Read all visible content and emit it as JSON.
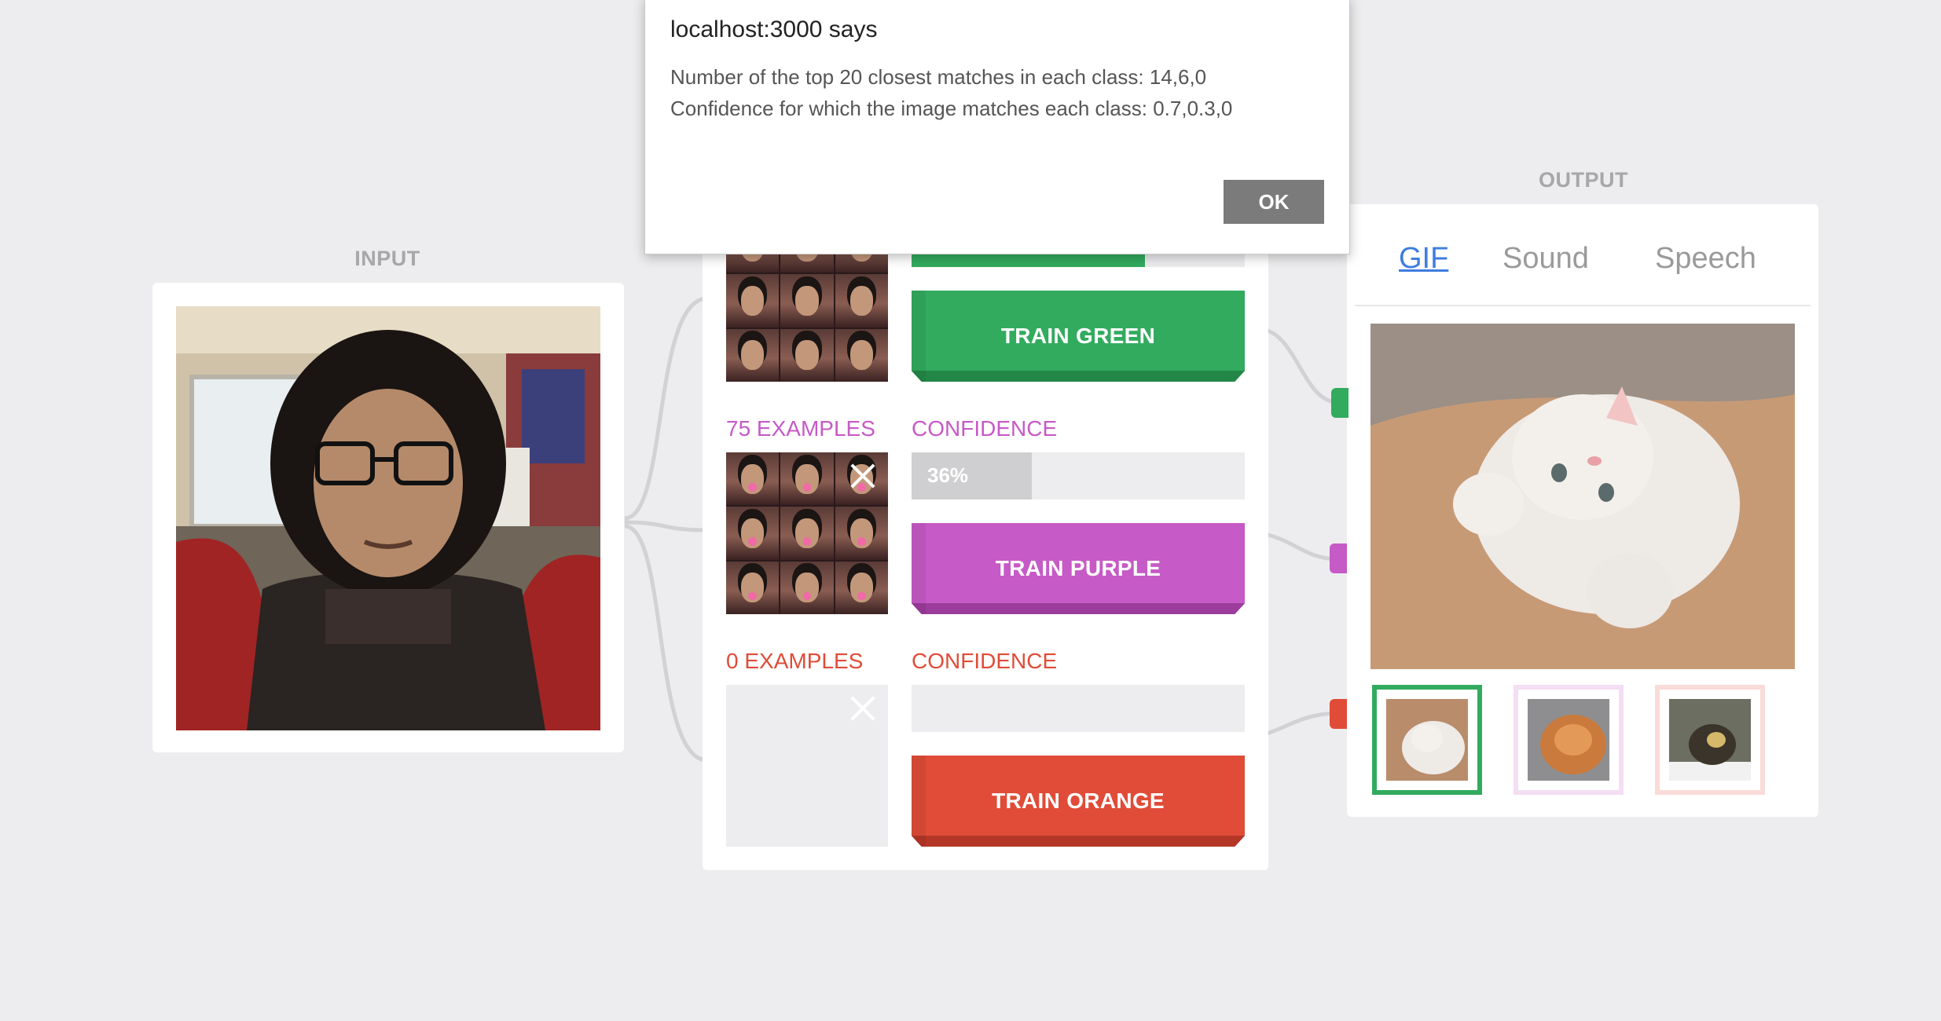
{
  "dialog": {
    "title": "localhost:3000 says",
    "line1": "Number of the top 20 closest matches in each class: 14,6,0",
    "line2": "Confidence for which the image matches each class: 0.7,0.3,0",
    "ok_label": "OK"
  },
  "input": {
    "section_label": "INPUT"
  },
  "output": {
    "section_label": "OUTPUT",
    "tabs": [
      {
        "label": "GIF",
        "active": true
      },
      {
        "label": "Sound",
        "active": false
      },
      {
        "label": "Speech",
        "active": false
      }
    ],
    "selected_thumb": 0
  },
  "classes": [
    {
      "color": "#32ab5e",
      "dark": "#228746",
      "examples": "",
      "confidence_label": "",
      "confidence": 0.7,
      "confidence_text": "",
      "train_label": "TRAIN GREEN"
    },
    {
      "color": "#c65ac6",
      "dark": "#9c3c9c",
      "examples": "75 EXAMPLES",
      "confidence_label": "CONFIDENCE",
      "confidence": 0.36,
      "confidence_text": "36%",
      "train_label": "TRAIN PURPLE"
    },
    {
      "color": "#e04c38",
      "dark": "#b43626",
      "examples": "0 EXAMPLES",
      "confidence_label": "CONFIDENCE",
      "confidence": 0,
      "confidence_text": "",
      "train_label": "TRAIN ORANGE"
    }
  ]
}
